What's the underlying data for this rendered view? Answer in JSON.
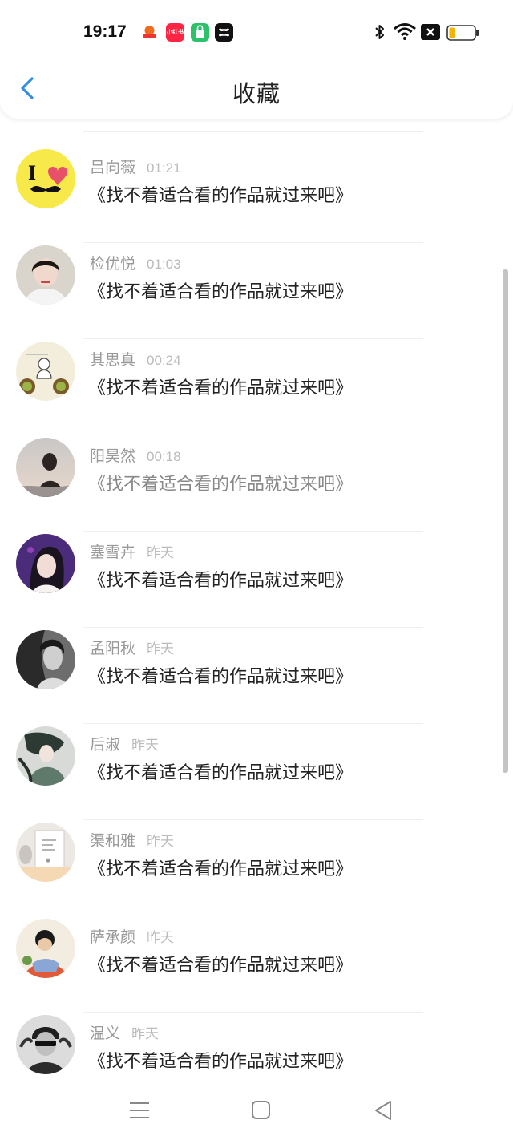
{
  "status_bar": {
    "time": "19:17",
    "apps": [
      {
        "icon": "app-icon-1"
      },
      {
        "icon": "xiaohongshu-icon",
        "label": "小红书"
      },
      {
        "icon": "shopping-bag-icon"
      },
      {
        "icon": "capcut-icon"
      }
    ],
    "icons": [
      "bluetooth-icon",
      "wifi-icon",
      "notification-off-icon",
      "battery-icon"
    ],
    "battery_level": 0.25
  },
  "header": {
    "title": "收藏",
    "back_icon": "chevron-left-icon"
  },
  "items": [
    {
      "name": "吕向薇",
      "time": "01:21",
      "message": "《找不着适合看的作品就过来吧》"
    },
    {
      "name": "检优悦",
      "time": "01:03",
      "message": "《找不着适合看的作品就过来吧》"
    },
    {
      "name": "其思真",
      "time": "00:24",
      "message": "《找不着适合看的作品就过来吧》"
    },
    {
      "name": "阳昊然",
      "time": "00:18",
      "message": "《找不着适合看的作品就过来吧》"
    },
    {
      "name": "塞雪卉",
      "time": "昨天",
      "message": "《找不着适合看的作品就过来吧》"
    },
    {
      "name": "孟阳秋",
      "time": "昨天",
      "message": "《找不着适合看的作品就过来吧》"
    },
    {
      "name": "后淑",
      "time": "昨天",
      "message": "《找不着适合看的作品就过来吧》"
    },
    {
      "name": "渠和雅",
      "time": "昨天",
      "message": "《找不着适合看的作品就过来吧》"
    },
    {
      "name": "萨承颜",
      "time": "昨天",
      "message": "《找不着适合看的作品就过来吧》"
    },
    {
      "name": "温义",
      "time": "昨天",
      "message": "《找不着适合看的作品就过来吧》"
    }
  ],
  "bottom_nav": [
    "menu-icon",
    "home-square-icon",
    "back-triangle-icon"
  ],
  "colors": {
    "accent": "#2f8fe6",
    "name_gray": "#999999",
    "message": "#222222"
  }
}
